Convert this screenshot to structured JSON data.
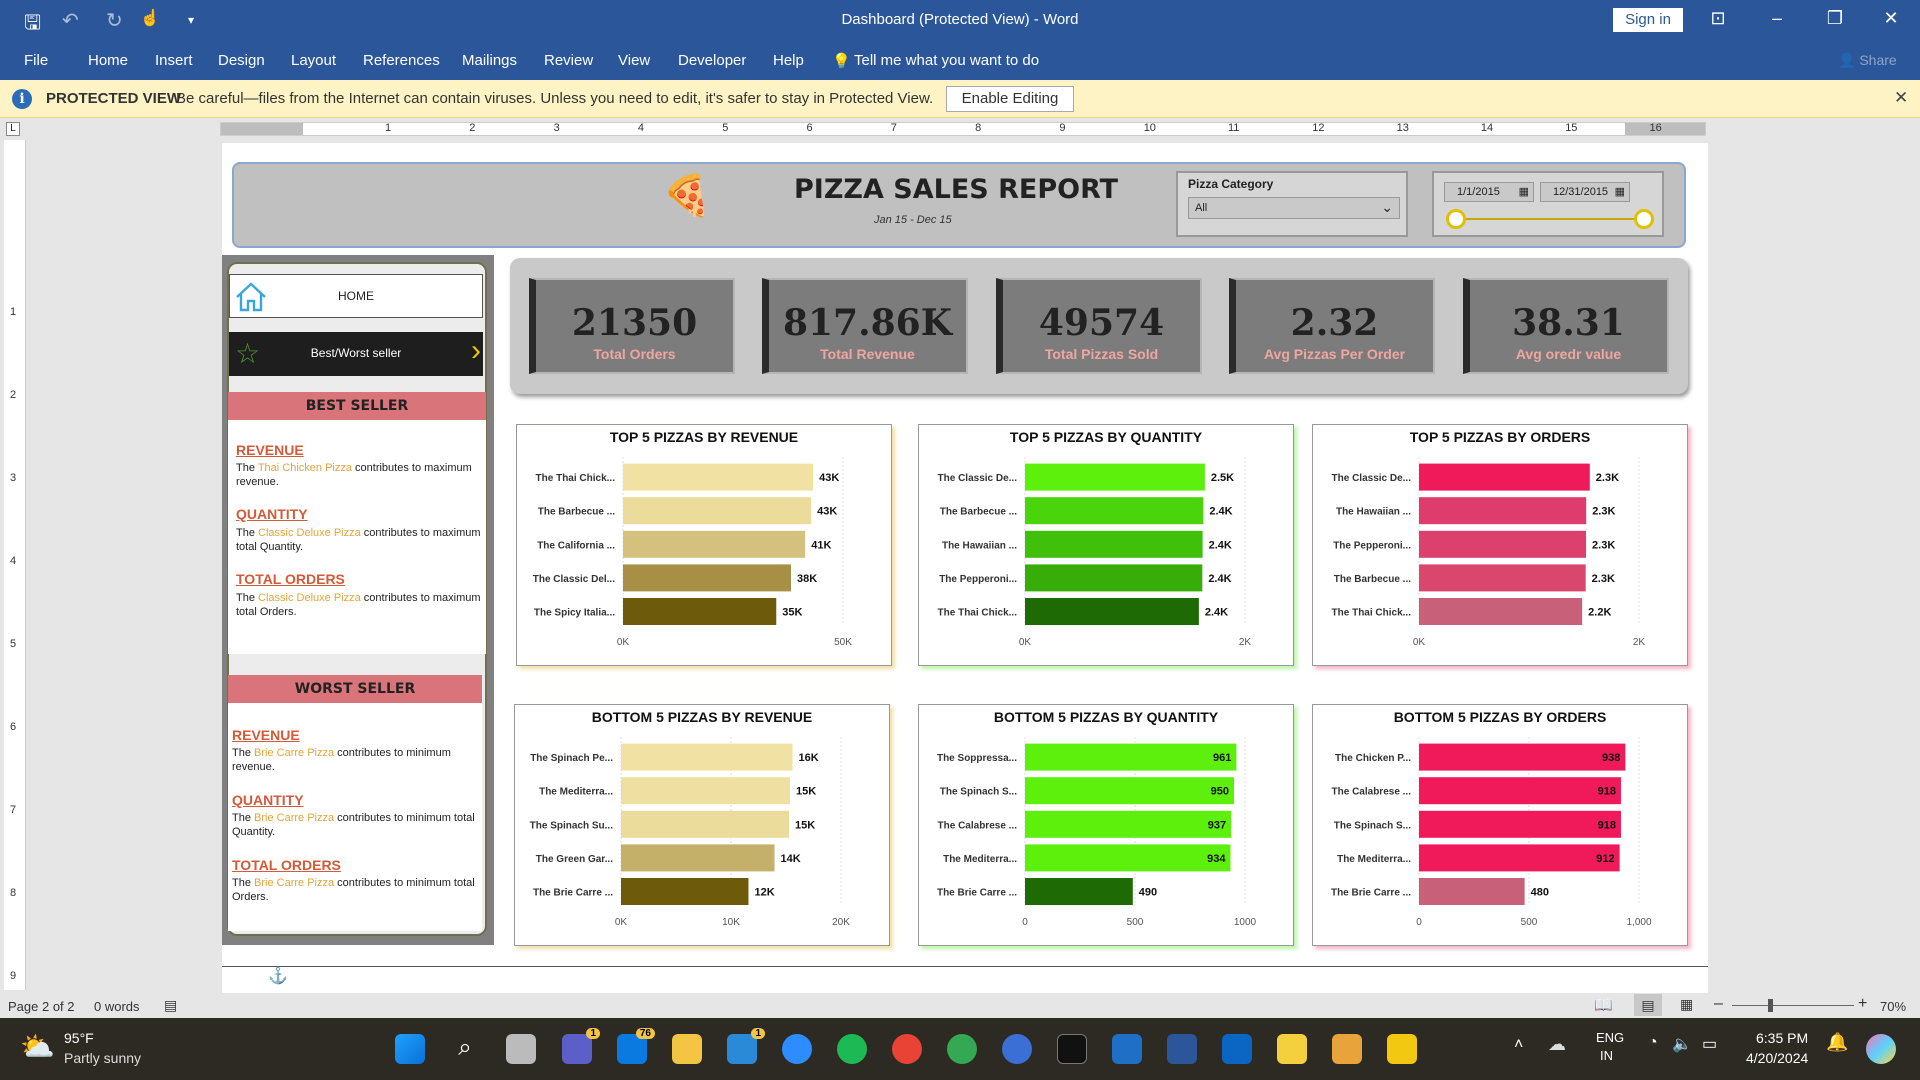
{
  "window": {
    "title": "Dashboard (Protected View)  -  Word",
    "sign_in": "Sign in",
    "share": "Share"
  },
  "menu": [
    "File",
    "Home",
    "Insert",
    "Design",
    "Layout",
    "References",
    "Mailings",
    "Review",
    "View",
    "Developer",
    "Help"
  ],
  "tell_me": "Tell me what you want to do",
  "protected_view": {
    "label": "PROTECTED VIEW",
    "message": "Be careful—files from the Internet can contain viruses. Unless you need to edit, it's safer to stay in Protected View.",
    "enable_button": "Enable Editing"
  },
  "ruler_numbers": [
    "1",
    "2",
    "3",
    "4",
    "5",
    "6",
    "7",
    "8",
    "9",
    "10",
    "11",
    "12",
    "13",
    "14",
    "15",
    "16"
  ],
  "vruler_numbers": [
    "1",
    "2",
    "3",
    "4",
    "5",
    "6",
    "7",
    "8",
    "9"
  ],
  "report": {
    "title": "PIZZA SALES REPORT",
    "subtitle": "Jan 15 - Dec 15",
    "category_label": "Pizza Category",
    "category_value": "All",
    "date_start": "1/1/2015",
    "date_end": "12/31/2015"
  },
  "nav": {
    "home": "HOME",
    "best_worst": "Best/Worst seller"
  },
  "best_seller": {
    "title": "BEST SELLER",
    "items": [
      {
        "head": "REVENUE",
        "pre": "The ",
        "pizza": "Thai Chicken Pizza",
        "post": " contributes to maximum revenue."
      },
      {
        "head": "QUANTITY",
        "pre": "The ",
        "pizza": "Classic Deluxe Pizza",
        "post": " contributes to maximum total Quantity."
      },
      {
        "head": "TOTAL ORDERS",
        "pre": "The ",
        "pizza": "Classic Deluxe Pizza",
        "post": " contributes to maximum total Orders."
      }
    ]
  },
  "worst_seller": {
    "title": "WORST SELLER",
    "items": [
      {
        "head": "REVENUE",
        "pre": "The  ",
        "pizza": "Brie Carre Pizza",
        "post": " contributes to minimum revenue."
      },
      {
        "head": "QUANTITY",
        "pre": "The  ",
        "pizza": "Brie Carre Pizza",
        "post": " contributes to minimum total Quantity."
      },
      {
        "head": "TOTAL ORDERS",
        "pre": " The ",
        "pizza": "Brie Carre Pizza",
        "post": " contributes to minimum total Orders."
      }
    ]
  },
  "kpis": [
    {
      "value": "21350",
      "label": "Total Orders"
    },
    {
      "value": "817.86K",
      "label": "Total Revenue"
    },
    {
      "value": "49574",
      "label": "Total Pizzas Sold"
    },
    {
      "value": "2.32",
      "label": "Avg Pizzas Per Order"
    },
    {
      "value": "38.31",
      "label": "Avg oredr value"
    }
  ],
  "chart_data": [
    {
      "type": "bar",
      "title": "TOP 5 PIZZAS BY REVENUE",
      "categories": [
        "The Thai Chick...",
        "The Barbecue ...",
        "The California ...",
        "The Classic Del...",
        "The Spicy Italia..."
      ],
      "values": [
        43217,
        42768,
        41410,
        38180,
        34831
      ],
      "labels": [
        "43K",
        "43K",
        "41K",
        "38K",
        "35K"
      ],
      "ticks": [
        "0K",
        "50K"
      ],
      "xlim": [
        0,
        50000
      ],
      "colors": [
        "#f1e2a4",
        "#ecdc9c",
        "#d4c17e",
        "#a78f46",
        "#6e5a0b"
      ],
      "label_inside": false
    },
    {
      "type": "bar",
      "title": "TOP 5 PIZZAS BY QUANTITY",
      "categories": [
        "The Classic De...",
        "The Barbecue ...",
        "The Hawaiian ...",
        "The Pepperoni...",
        "The Thai Chick..."
      ],
      "values": [
        2453,
        2432,
        2422,
        2418,
        2371
      ],
      "labels": [
        "2.5K",
        "2.4K",
        "2.4K",
        "2.4K",
        "2.4K"
      ],
      "ticks": [
        "0K",
        "2K"
      ],
      "xlim": [
        0,
        3000
      ],
      "colors": [
        "#5cf00c",
        "#49d40b",
        "#3fc00a",
        "#38ad09",
        "#1e6a05"
      ],
      "label_inside": false
    },
    {
      "type": "bar",
      "title": "TOP 5 PIZZAS BY ORDERS",
      "categories": [
        "The Classic De...",
        "The Hawaiian ...",
        "The Pepperoni...",
        "The Barbecue ...",
        "The Thai Chick..."
      ],
      "values": [
        2329,
        2280,
        2278,
        2273,
        2225
      ],
      "labels": [
        "2.3K",
        "2.3K",
        "2.3K",
        "2.3K",
        "2.2K"
      ],
      "ticks": [
        "0K",
        "2K"
      ],
      "xlim": [
        0,
        3000
      ],
      "colors": [
        "#f0195a",
        "#de3c6c",
        "#dc416d",
        "#d9466e",
        "#c9607a"
      ],
      "label_inside": false
    },
    {
      "type": "bar",
      "title": "BOTTOM 5 PIZZAS BY REVENUE",
      "categories": [
        "The Spinach Pe...",
        "The Mediterra...",
        "The Spinach Su...",
        "The Green Gar...",
        "The Brie Carre ..."
      ],
      "values": [
        15596,
        15360,
        15278,
        13956,
        11588
      ],
      "labels": [
        "16K",
        "15K",
        "15K",
        "14K",
        "12K"
      ],
      "ticks": [
        "0K",
        "10K",
        "20K"
      ],
      "xlim": [
        0,
        20000
      ],
      "colors": [
        "#f1e2a4",
        "#efdfa0",
        "#ecdc9c",
        "#c4b069",
        "#6e5a0b"
      ],
      "label_inside": false
    },
    {
      "type": "bar",
      "title": "BOTTOM 5 PIZZAS BY QUANTITY",
      "categories": [
        "The Soppressa...",
        "The Spinach S...",
        "The Calabrese ...",
        "The Mediterra...",
        "The Brie Carre ..."
      ],
      "values": [
        961,
        950,
        937,
        934,
        490
      ],
      "labels": [
        "961",
        "950",
        "937",
        "934",
        "490"
      ],
      "ticks": [
        "0",
        "500",
        "1000"
      ],
      "xlim": [
        0,
        1000
      ],
      "colors": [
        "#5cf00c",
        "#5cf00c",
        "#5cf00c",
        "#5cf00c",
        "#1e6a05"
      ],
      "label_inside": true
    },
    {
      "type": "bar",
      "title": "BOTTOM 5 PIZZAS BY ORDERS",
      "categories": [
        "The Chicken P...",
        "The Calabrese ...",
        "The Spinach S...",
        "The Mediterra...",
        "The Brie Carre ..."
      ],
      "values": [
        938,
        918,
        918,
        912,
        480
      ],
      "labels": [
        "938",
        "918",
        "918",
        "912",
        "480"
      ],
      "ticks": [
        "0",
        "500",
        "1,000"
      ],
      "xlim": [
        0,
        1000
      ],
      "colors": [
        "#f0195a",
        "#f0195a",
        "#f0195a",
        "#f0195a",
        "#c9607a"
      ],
      "label_inside": true
    }
  ],
  "status": {
    "page": "Page 2 of 2",
    "words": "0 words",
    "zoom": "70%"
  },
  "taskbar": {
    "temp": "95°F",
    "weather": "Partly sunny",
    "lang1": "ENG",
    "lang2": "IN",
    "time": "6:35 PM",
    "date": "4/20/2024",
    "badge_teams": "1",
    "badge_store": "76",
    "badge_mail": "1"
  }
}
